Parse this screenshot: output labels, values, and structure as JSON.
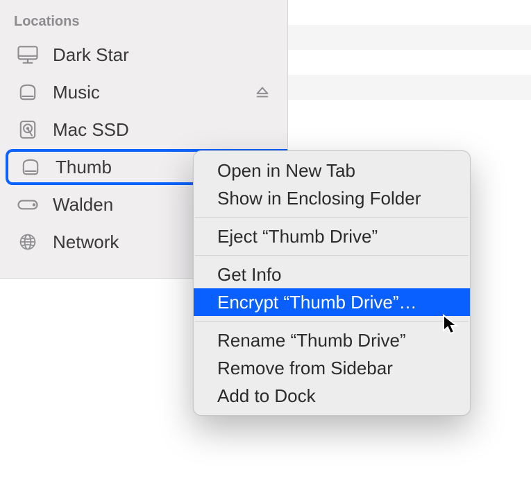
{
  "sidebar": {
    "section_title": "Locations",
    "items": [
      {
        "label": "Dark Star",
        "icon": "imac-icon"
      },
      {
        "label": "Music",
        "icon": "disk-icon",
        "ejectable": true
      },
      {
        "label": "Mac SSD",
        "icon": "hdd-icon"
      },
      {
        "label": "Thumb",
        "icon": "disk-icon",
        "selected": true
      },
      {
        "label": "Walden",
        "icon": "timecapsule-icon"
      },
      {
        "label": "Network",
        "icon": "globe-icon"
      }
    ]
  },
  "context_menu": {
    "groups": [
      [
        "Open in New Tab",
        "Show in Enclosing Folder"
      ],
      [
        "Eject “Thumb Drive”"
      ],
      [
        "Get Info",
        "Encrypt “Thumb Drive”…"
      ],
      [
        "Rename “Thumb Drive”",
        "Remove from Sidebar",
        "Add to Dock"
      ]
    ],
    "highlighted": "Encrypt “Thumb Drive”…"
  }
}
